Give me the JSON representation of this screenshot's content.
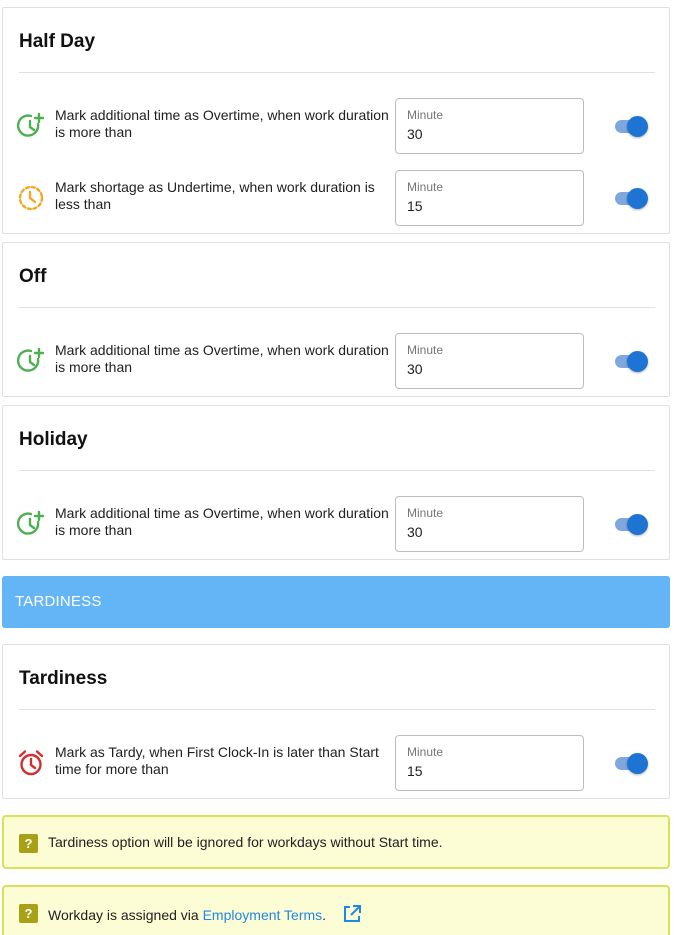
{
  "cards": {
    "half_day": {
      "title": "Half Day",
      "rows": [
        {
          "icon": "overtime-clock-plus-icon",
          "text": "Mark additional time as Overtime, when work duration is more than",
          "field_label": "Minute",
          "value": "30",
          "enabled": true
        },
        {
          "icon": "undertime-clock-dashed-icon",
          "text": "Mark shortage as Undertime, when work duration is less than",
          "field_label": "Minute",
          "value": "15",
          "enabled": true
        }
      ]
    },
    "off": {
      "title": "Off",
      "rows": [
        {
          "icon": "overtime-clock-plus-icon",
          "text": "Mark additional time as Overtime, when work duration is more than",
          "field_label": "Minute",
          "value": "30",
          "enabled": true
        }
      ]
    },
    "holiday": {
      "title": "Holiday",
      "rows": [
        {
          "icon": "overtime-clock-plus-icon",
          "text": "Mark additional time as Overtime, when work duration is more than",
          "field_label": "Minute",
          "value": "30",
          "enabled": true
        }
      ]
    },
    "tardiness": {
      "title": "Tardiness",
      "rows": [
        {
          "icon": "alarm-clock-icon",
          "text": "Mark as Tardy, when First Clock-In is later than Start time for more than",
          "field_label": "Minute",
          "value": "15",
          "enabled": true
        }
      ]
    }
  },
  "section_header": "TARDINESS",
  "notices": {
    "tardiness_note": {
      "icon": "help-icon",
      "text": "Tardiness option will be ignored for workdays without Start time."
    },
    "workday_note": {
      "icon": "help-icon",
      "text_before": "Workday is assigned via ",
      "link": "Employment Terms",
      "text_after": ".",
      "link_icon": "external-link-icon"
    }
  },
  "colors": {
    "overtime_icon": "#4caf50",
    "undertime_icon": "#f5a623",
    "tardy_icon": "#d32f2f",
    "toggle_on": "#1e74d2",
    "section_bar": "#64b5f6",
    "notice_bg": "#fdfdd5",
    "notice_border": "#d6e35a",
    "link": "#1e88e5"
  }
}
